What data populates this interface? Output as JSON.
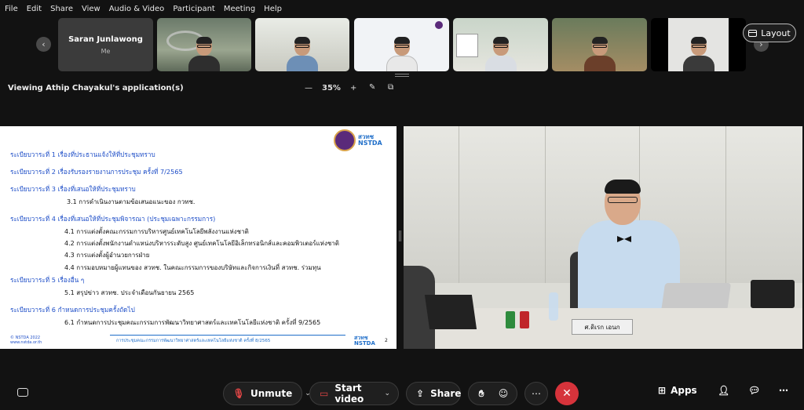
{
  "menu": [
    "File",
    "Edit",
    "Share",
    "View",
    "Audio & Video",
    "Participant",
    "Meeting",
    "Help"
  ],
  "self_tile": {
    "name": "Saran Junlawong",
    "role": "Me"
  },
  "layout_label": "Layout",
  "share": {
    "title": "Viewing Athip Chayakul's application(s)",
    "zoom_minus": "—",
    "zoom": "35%",
    "zoom_plus": "+"
  },
  "slide": {
    "logo_text": "สวทช\nNSTDA",
    "agenda": [
      {
        "title": "ระเบียบวาระที่ 1   เรื่องที่ประธานแจ้งให้ที่ประชุมทราบ",
        "subs": []
      },
      {
        "title": "ระเบียบวาระที่ 2   เรื่องรับรองรายงานการประชุม ครั้งที่ 7/2565",
        "subs": []
      },
      {
        "title": "ระเบียบวาระที่ 3   เรื่องที่เสนอให้ที่ประชุมทราบ",
        "subs": [
          "3.1 การดำเนินงานตามข้อเสนอแนะของ กวทช."
        ]
      },
      {
        "title": "ระเบียบวาระที่ 4   เรื่องที่เสนอให้ที่ประชุมพิจารณา (ประชุมเฉพาะกรรมการ)",
        "subs": [
          "4.1 การแต่งตั้งคณะกรรมการบริหารศูนย์เทคโนโลยีพลังงานแห่งชาติ",
          "4.2 การแต่งตั้งพนักงานดำแหน่งบริหารระดับสูง ศูนย์เทคโนโลยีอิเล็กทรอนิกส์และคอมพิวเตอร์แห่งชาติ",
          "4.3 การแต่งตั้งผู้อำนวยการฝ่าย",
          "4.4 การมอบหมายผู้แทนของ สวทช. ในคณะกรรมการของบริษัทและกิจการเงินที่ สวทช. ร่วมทุน"
        ]
      },
      {
        "title": "ระเบียบวาระที่ 5   เรื่องอื่น ๆ",
        "subs": [
          "5.1 สรุปข่าว สวทช. ประจำเดือนกันยายน 2565"
        ]
      },
      {
        "title": "ระเบียบวาระที่ 6   กำหนดการประชุมครั้งถัดไป",
        "subs": [
          "6.1 กำหนดการประชุมคณะกรรมการพัฒนาวิทยาศาสตร์และเทคโนโลยีแห่งชาติ ครั้งที่ 9/2565"
        ]
      }
    ],
    "footer_left": "© NSTDA 2022\nwww.nstda.or.th",
    "footer_center": "การประชุมคณะกรรมการพัฒนาวิทยาศาสตร์และเทคโนโลยีแห่งชาติ ครั้งที่ 8/2565",
    "footer_right": "สวทช\nNSTDA",
    "page": "2"
  },
  "video": {
    "nameplate": "ศ.ดิเรก เอนก"
  },
  "toolbar": {
    "unmute": "Unmute",
    "start_video": "Start video",
    "share": "Share",
    "apps": "Apps"
  },
  "colors": {
    "end_call": "#d6333b",
    "slide_text": "#1f4fc8",
    "unmute_icon": "#e04646"
  }
}
